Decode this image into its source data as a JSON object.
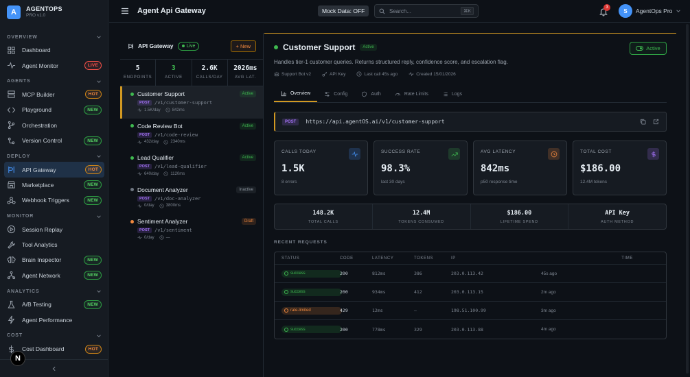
{
  "brand": {
    "name": "AGENTOPS",
    "version": "PRO v1.0",
    "logo_letter": "A"
  },
  "sidebar": {
    "sections": [
      {
        "title": "OVERVIEW",
        "items": [
          {
            "label": "Dashboard",
            "icon": "dashboard-icon",
            "badge": null
          },
          {
            "label": "Agent Monitor",
            "icon": "pulse-icon",
            "badge": "LIVE"
          }
        ]
      },
      {
        "title": "AGENTS",
        "items": [
          {
            "label": "MCP Builder",
            "icon": "server-icon",
            "badge": "HOT"
          },
          {
            "label": "Playground",
            "icon": "code-icon",
            "badge": "NEW"
          },
          {
            "label": "Orchestration",
            "icon": "branch-icon",
            "badge": null
          },
          {
            "label": "Version Control",
            "icon": "git-icon",
            "badge": "NEW"
          }
        ]
      },
      {
        "title": "DEPLOY",
        "items": [
          {
            "label": "API Gateway",
            "icon": "gateway-icon",
            "badge": "HOT",
            "active": true
          },
          {
            "label": "Marketplace",
            "icon": "store-icon",
            "badge": "NEW"
          },
          {
            "label": "Webhook Triggers",
            "icon": "webhook-icon",
            "badge": "NEW"
          }
        ]
      },
      {
        "title": "MONITOR",
        "items": [
          {
            "label": "Session Replay",
            "icon": "play-icon",
            "badge": null
          },
          {
            "label": "Tool Analytics",
            "icon": "wrench-icon",
            "badge": null
          },
          {
            "label": "Brain Inspector",
            "icon": "brain-icon",
            "badge": "NEW"
          },
          {
            "label": "Agent Network",
            "icon": "network-icon",
            "badge": "NEW"
          }
        ]
      },
      {
        "title": "ANALYTICS",
        "items": [
          {
            "label": "A/B Testing",
            "icon": "flask-icon",
            "badge": "NEW"
          },
          {
            "label": "Agent Performance",
            "icon": "bolt-icon",
            "badge": null
          }
        ]
      },
      {
        "title": "COST",
        "items": [
          {
            "label": "Cost Dashboard",
            "icon": "dollar-icon",
            "badge": "HOT"
          },
          {
            "label": "Cost Forecast",
            "icon": "trend-icon",
            "badge": null
          }
        ]
      }
    ],
    "footer_letter": "N"
  },
  "topbar": {
    "title": "Agent Api Gateway",
    "mock_data": "Mock Data: OFF",
    "search_placeholder": "Search...",
    "search_shortcut": "⌘K",
    "notification_count": "3",
    "user_initial": "S",
    "user_name": "AgentOps Pro"
  },
  "gateway": {
    "title": "API Gateway",
    "status": "Live",
    "new_button": "New",
    "stats": [
      {
        "value": "5",
        "label": "ENDPOINTS",
        "accent": false
      },
      {
        "value": "3",
        "label": "ACTIVE",
        "accent": true
      },
      {
        "value": "2.6K",
        "label": "CALLS/DAY",
        "accent": false
      },
      {
        "value": "2026ms",
        "label": "AVG LAT.",
        "accent": false
      }
    ],
    "endpoints": [
      {
        "name": "Customer Support",
        "status": "Active",
        "method": "POST",
        "path": "/v1/customer-support",
        "calls": "1.5K/day",
        "latency": "842ms",
        "dot": "#3fb950",
        "selected": true
      },
      {
        "name": "Code Review Bot",
        "status": "Active",
        "method": "POST",
        "path": "/v1/code-review",
        "calls": "432/day",
        "latency": "2340ms",
        "dot": "#3fb950",
        "selected": false
      },
      {
        "name": "Lead Qualifier",
        "status": "Active",
        "method": "POST",
        "path": "/v1/lead-qualifier",
        "calls": "640/day",
        "latency": "1120ms",
        "dot": "#3fb950",
        "selected": false
      },
      {
        "name": "Document Analyzer",
        "status": "Inactive",
        "method": "POST",
        "path": "/v1/doc-analyzer",
        "calls": "0/day",
        "latency": "3800ms",
        "dot": "#6e7681",
        "selected": false
      },
      {
        "name": "Sentiment Analyzer",
        "status": "Draft",
        "method": "POST",
        "path": "/v1/sentiment",
        "calls": "0/day",
        "latency": "—",
        "dot": "#f0883e",
        "selected": false
      }
    ]
  },
  "detail": {
    "title": "Customer Support",
    "status": "Active",
    "toggle_label": "Active",
    "description": "Handles tier-1 customer queries. Returns structured reply, confidence score, and escalation flag.",
    "meta": [
      {
        "icon": "bot-icon",
        "text": "Support Bot v2"
      },
      {
        "icon": "key-icon",
        "text": "API Key"
      },
      {
        "icon": "clock-icon",
        "text": "Last call 45s ago"
      },
      {
        "icon": "pulse-icon",
        "text": "Created 15/01/2026"
      }
    ],
    "tabs": [
      {
        "label": "Overview",
        "icon": "chart-icon",
        "active": true
      },
      {
        "label": "Config",
        "icon": "sliders-icon",
        "active": false
      },
      {
        "label": "Auth",
        "icon": "shield-icon",
        "active": false
      },
      {
        "label": "Rate Limits",
        "icon": "gauge-icon",
        "active": false
      },
      {
        "label": "Logs",
        "icon": "list-icon",
        "active": false
      }
    ],
    "method": "POST",
    "url": "https://api.agentOS.ai/v1/customer-support",
    "cards": [
      {
        "label": "CALLS TODAY",
        "value": "1.5K",
        "sub": "8 errors",
        "icon": "pulse-icon",
        "color": "#4493f8"
      },
      {
        "label": "SUCCESS RATE",
        "value": "98.3%",
        "sub": "last 30 days",
        "icon": "trend-icon",
        "color": "#3fb950"
      },
      {
        "label": "AVG LATENCY",
        "value": "842ms",
        "sub": "p50 response time",
        "icon": "clock-icon",
        "color": "#f0883e"
      },
      {
        "label": "TOTAL COST",
        "value": "$186.00",
        "sub": "12.4M tokens",
        "icon": "dollar-icon",
        "color": "#a371f7"
      }
    ],
    "totals": [
      {
        "value": "148.2K",
        "label": "TOTAL CALLS"
      },
      {
        "value": "12.4M",
        "label": "TOKENS CONSUMED"
      },
      {
        "value": "$186.00",
        "label": "LIFETIME SPEND"
      },
      {
        "value": "API Key",
        "label": "AUTH METHOD"
      }
    ],
    "recent_title": "RECENT REQUESTS",
    "columns": [
      "STATUS",
      "CODE",
      "LATENCY",
      "TOKENS",
      "IP",
      "TIME"
    ],
    "requests": [
      {
        "status": "success",
        "code": "200",
        "latency": "812ms",
        "tokens": "386",
        "ip": "203.0.113.42",
        "time": "45s ago"
      },
      {
        "status": "success",
        "code": "200",
        "latency": "934ms",
        "tokens": "412",
        "ip": "203.0.113.15",
        "time": "2m ago"
      },
      {
        "status": "rate-limited",
        "code": "429",
        "latency": "12ms",
        "tokens": "—",
        "ip": "198.51.100.99",
        "time": "3m ago"
      },
      {
        "status": "success",
        "code": "200",
        "latency": "778ms",
        "tokens": "329",
        "ip": "203.0.113.88",
        "time": "4m ago"
      }
    ]
  }
}
